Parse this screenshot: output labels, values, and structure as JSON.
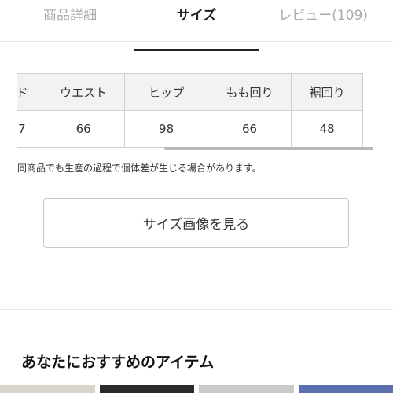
{
  "tabs": [
    {
      "label": "商品詳細"
    },
    {
      "label": "サイズ"
    },
    {
      "label": "レビュー(109)"
    }
  ],
  "size_table": {
    "headers": [
      "ド",
      "ウエスト",
      "ヒップ",
      "もも回り",
      "裾回り"
    ],
    "values": [
      "7",
      "66",
      "98",
      "66",
      "48"
    ]
  },
  "note": "同商品でも生産の過程で個体差が生じる場合があります。",
  "view_button_label": "サイズ画像を見る",
  "recommend_title": "あなたにおすすめのアイテム",
  "colors": {
    "accent": "#222222",
    "muted": "#aaaaaa",
    "border": "#cfcfcf"
  }
}
